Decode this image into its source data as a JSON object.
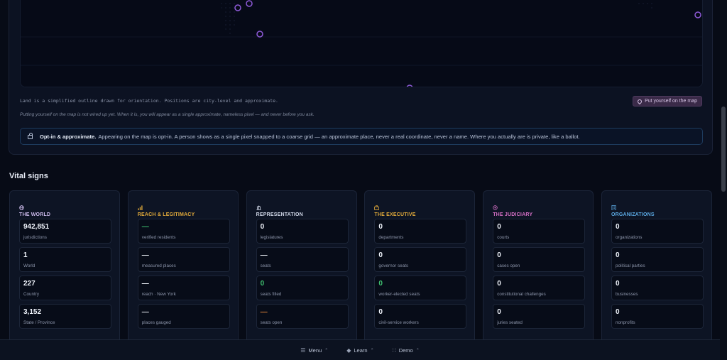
{
  "map": {
    "land_note": "Land is a simplified outline drawn for orientation. Positions are city-level and approximate.",
    "put_button_label": "Put yourself on the map",
    "wired_note": "Putting yourself on the map is not wired up yet. When it is, you will appear as a single approximate, nameless pixel — and never before you ask.",
    "marker_color": "#8e5ad8"
  },
  "optin": {
    "bold": "Opt-in & approximate.",
    "text": "Appearing on the map is opt-in. A person shows as a single pixel snapped to a coarse grid — an approximate place, never a real coordinate, never a name. Where you actually are is private, like a ballot."
  },
  "vital_signs": {
    "title": "Vital signs",
    "panels": [
      {
        "title": "THE WORLD",
        "icon": "globe-icon",
        "color": "#c9b8e8",
        "tiles": [
          {
            "value": "942,851",
            "label": "jurisdictions",
            "color": "#f0f4fb"
          },
          {
            "value": "1",
            "label": "World",
            "color": "#f0f4fb"
          },
          {
            "value": "227",
            "label": "Country",
            "color": "#f0f4fb"
          },
          {
            "value": "3,152",
            "label": "State / Province",
            "color": "#f0f4fb"
          }
        ]
      },
      {
        "title": "REACH & LEGITIMACY",
        "icon": "bar-chart-icon",
        "color": "#e0a93a",
        "tiles": [
          {
            "value": "—",
            "label": "verified residents",
            "color": "#3fbf6f"
          },
          {
            "value": "—",
            "label": "measured places",
            "color": "#f0f4fb"
          },
          {
            "value": "—",
            "label": "reach · New York",
            "color": "#f0f4fb"
          },
          {
            "value": "—",
            "label": "places gauged",
            "color": "#f0f4fb"
          }
        ]
      },
      {
        "title": "REPRESENTATION",
        "icon": "capitol-icon",
        "color": "#cfd6e6",
        "tiles": [
          {
            "value": "0",
            "label": "legislatures",
            "color": "#f0f4fb"
          },
          {
            "value": "—",
            "label": "seats",
            "color": "#f0f4fb"
          },
          {
            "value": "0",
            "label": "seats filled",
            "color": "#3fbf6f"
          },
          {
            "value": "—",
            "label": "seats open",
            "color": "#e0833a"
          }
        ]
      },
      {
        "title": "THE EXECUTIVE",
        "icon": "briefcase-icon",
        "color": "#e0a93a",
        "tiles": [
          {
            "value": "0",
            "label": "departments",
            "color": "#f0f4fb"
          },
          {
            "value": "0",
            "label": "governor seats",
            "color": "#f0f4fb"
          },
          {
            "value": "0",
            "label": "worker-elected seats",
            "color": "#3fbf6f"
          },
          {
            "value": "0",
            "label": "civil-service workers",
            "color": "#f0f4fb"
          }
        ]
      },
      {
        "title": "THE JUDICIARY",
        "icon": "gavel-icon",
        "color": "#d46fc4",
        "tiles": [
          {
            "value": "0",
            "label": "courts",
            "color": "#f0f4fb"
          },
          {
            "value": "0",
            "label": "cases open",
            "color": "#f0f4fb"
          },
          {
            "value": "0",
            "label": "constitutional challenges",
            "color": "#f0f4fb"
          },
          {
            "value": "0",
            "label": "juries seated",
            "color": "#f0f4fb"
          }
        ]
      },
      {
        "title": "ORGANIZATIONS",
        "icon": "building-icon",
        "color": "#5aa7e0",
        "tiles": [
          {
            "value": "0",
            "label": "organizations",
            "color": "#f0f4fb"
          },
          {
            "value": "0",
            "label": "political parties",
            "color": "#f0f4fb"
          },
          {
            "value": "0",
            "label": "businesses",
            "color": "#f0f4fb"
          },
          {
            "value": "0",
            "label": "nonprofits",
            "color": "#f0f4fb"
          }
        ]
      }
    ]
  },
  "bottom_nav": [
    {
      "label": "Menu",
      "icon": "menu-icon"
    },
    {
      "label": "Learn",
      "icon": "graduation-cap-icon"
    },
    {
      "label": "Demo",
      "icon": "grid-icon"
    }
  ]
}
